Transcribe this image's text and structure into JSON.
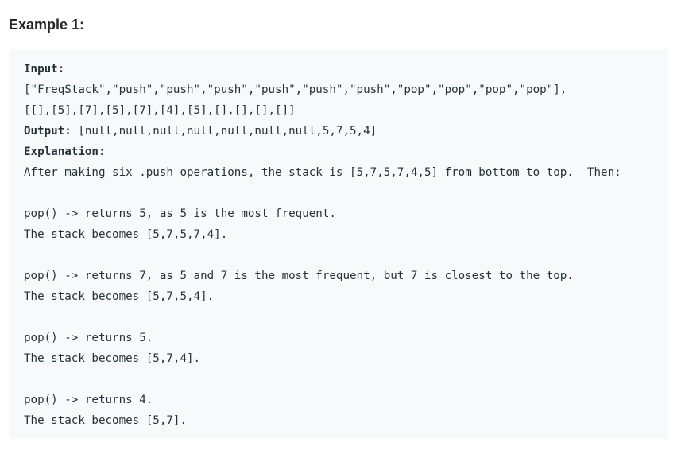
{
  "heading": "Example 1:",
  "input": {
    "label": "Input:",
    "line1": "[\"FreqStack\",\"push\",\"push\",\"push\",\"push\",\"push\",\"push\",\"pop\",\"pop\",\"pop\",\"pop\"],",
    "line2": "[[],[5],[7],[5],[7],[4],[5],[],[],[],[]]"
  },
  "output": {
    "label": "Output:",
    "value": " [null,null,null,null,null,null,null,5,7,5,4]"
  },
  "explanation": {
    "label": "Explanation",
    "colon": ":",
    "intro": "After making six .push operations, the stack is [5,7,5,7,4,5] from bottom to top.  Then:",
    "steps": [
      {
        "call": "pop() -> returns 5, as 5 is the most frequent.",
        "result": "The stack becomes [5,7,5,7,4]."
      },
      {
        "call": "pop() -> returns 7, as 5 and 7 is the most frequent, but 7 is closest to the top.",
        "result": "The stack becomes [5,7,5,4]."
      },
      {
        "call": "pop() -> returns 5.",
        "result": "The stack becomes [5,7,4]."
      },
      {
        "call": "pop() -> returns 4.",
        "result": "The stack becomes [5,7]."
      }
    ]
  }
}
